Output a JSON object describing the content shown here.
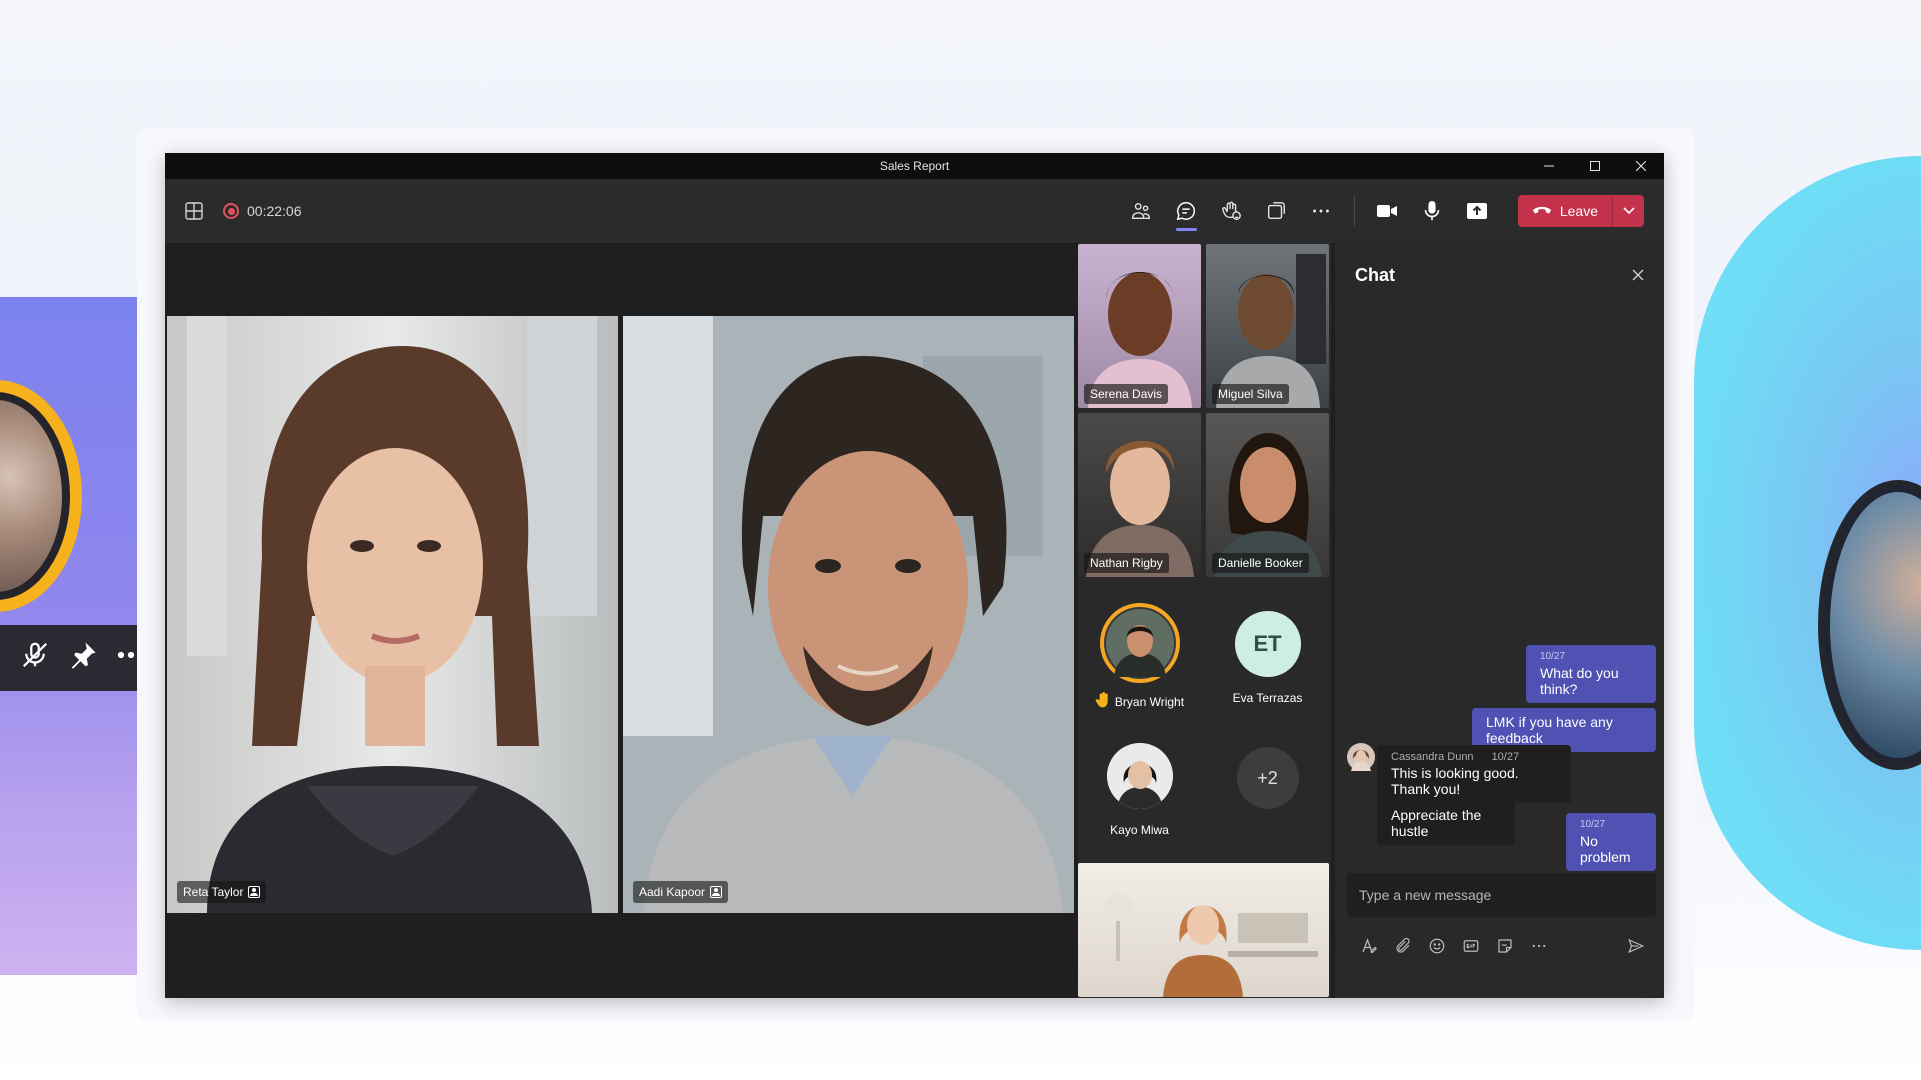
{
  "window": {
    "title": "Sales Report",
    "controls": [
      "—",
      "☐",
      "✕"
    ]
  },
  "toolbar": {
    "timer": "00:22:06",
    "leave_label": "Leave"
  },
  "stage": {
    "participants": [
      {
        "name": "Reta Taylor"
      },
      {
        "name": "Aadi Kapoor"
      }
    ]
  },
  "gallery": {
    "video_tiles": [
      {
        "name": "Serena Davis"
      },
      {
        "name": "Miguel Silva"
      },
      {
        "name": "Nathan Rigby"
      },
      {
        "name": "Danielle Booker"
      }
    ],
    "avatars": [
      {
        "name": "Bryan Wright",
        "hand_raised": true
      },
      {
        "name": "Eva Terrazas",
        "initials": "ET"
      },
      {
        "name": "Kayo Miwa"
      },
      {
        "name": "",
        "overflow": "+2"
      }
    ]
  },
  "chat": {
    "title": "Chat",
    "messages": [
      {
        "from": "me",
        "date": "10/27",
        "text": "What do you think?"
      },
      {
        "from": "me",
        "text": "LMK if you have any feedback"
      },
      {
        "from": "Cassandra Dunn",
        "date": "10/27",
        "text": "This is looking good. Thank you!"
      },
      {
        "from": "Cassandra Dunn",
        "text": "Appreciate the hustle"
      },
      {
        "from": "me",
        "date": "10/27",
        "text": "No problem"
      }
    ],
    "compose_placeholder": "Type a new message"
  },
  "colors": {
    "accent": "#4f52b2",
    "leave": "#c4314b",
    "recording": "#e0525f",
    "raised_hand": "#f5b21d"
  }
}
